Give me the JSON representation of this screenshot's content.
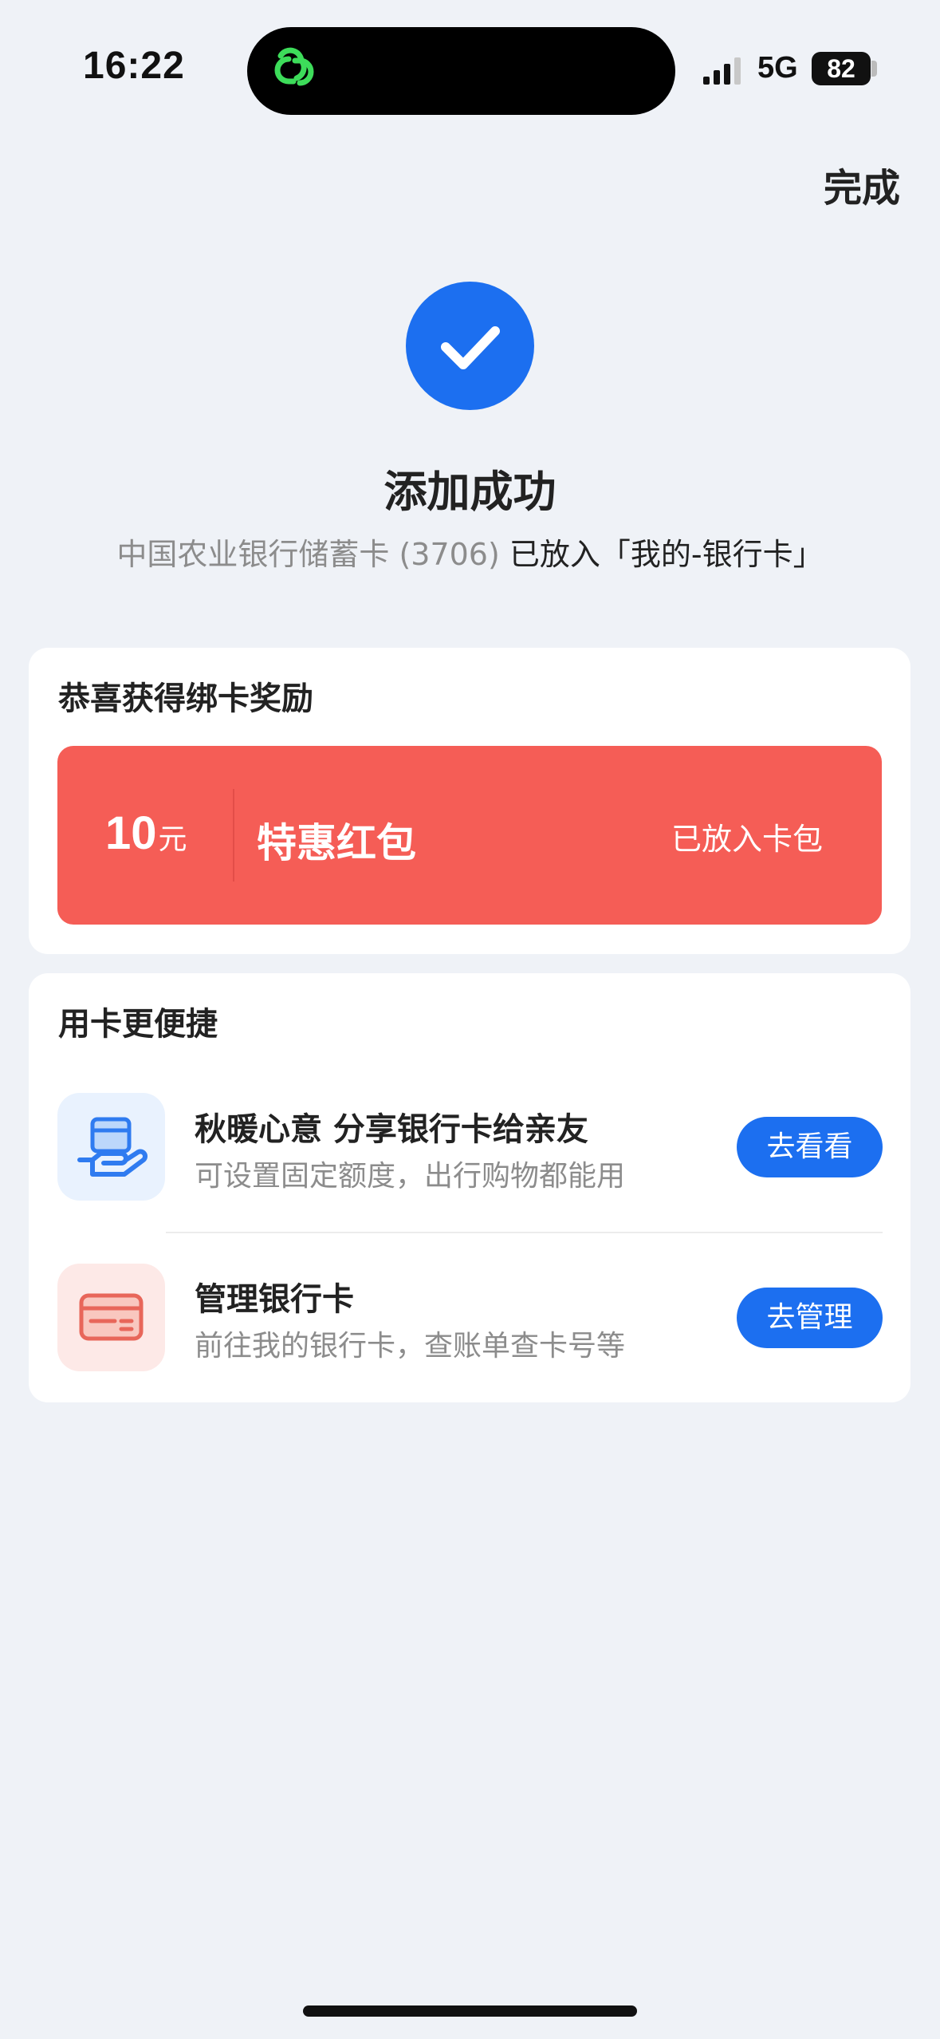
{
  "status_bar": {
    "time": "16:22",
    "network": "5G",
    "battery": "82"
  },
  "header": {
    "done_label": "完成"
  },
  "success": {
    "title": "添加成功",
    "card_name": "中国农业银行储蓄卡 (3706)",
    "placement": "已放入「我的-银行卡」"
  },
  "reward_section": {
    "title": "恭喜获得绑卡奖励",
    "amount": "10",
    "unit": "元",
    "name": "特惠红包",
    "status": "已放入卡包"
  },
  "convenience_section": {
    "title": "用卡更便捷",
    "items": [
      {
        "title": "秋暖心意 分享银行卡给亲友",
        "desc": "可设置固定额度，出行购物都能用",
        "button": "去看看",
        "icon": "share-card-hand-icon"
      },
      {
        "title": "管理银行卡",
        "desc": "前往我的银行卡，查账单查卡号等",
        "button": "去管理",
        "icon": "bank-card-icon"
      }
    ]
  },
  "colors": {
    "accent_blue": "#1c6ff0",
    "reward_red": "#f55d56",
    "background": "#eff2f7",
    "app_green": "#3ddc5a"
  }
}
